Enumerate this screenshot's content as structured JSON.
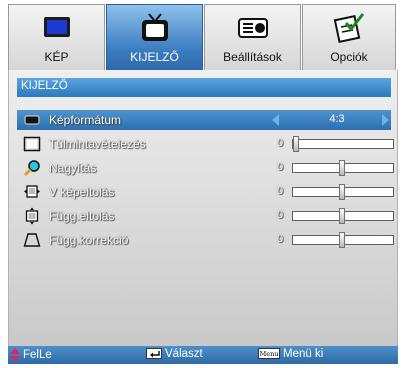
{
  "tabs": [
    {
      "label": "KÉP",
      "icon": "display-icon",
      "active": false
    },
    {
      "label": "KIJELZŐ",
      "icon": "tv-icon",
      "active": true
    },
    {
      "label": "Beállítások",
      "icon": "projector-icon",
      "active": false
    },
    {
      "label": "Opciók",
      "icon": "checklist-icon",
      "active": false
    }
  ],
  "section": {
    "title": "KIJELZŐ"
  },
  "menu": {
    "rows": [
      {
        "label": "Képformátum",
        "icon": "aspect-ratio-icon",
        "value": "4:3",
        "type": "choice",
        "selected": true
      },
      {
        "label": "Túlmintavételezés",
        "icon": "overscan-icon",
        "value": "0",
        "type": "slider",
        "level": 0.0
      },
      {
        "label": "Nagyítás",
        "icon": "magnifier-icon",
        "value": "0",
        "type": "slider",
        "level": 0.5
      },
      {
        "label": "V képeltolás",
        "icon": "h-shift-icon",
        "value": "0",
        "type": "slider",
        "level": 0.5
      },
      {
        "label": "Függ.eltolás",
        "icon": "v-shift-icon",
        "value": "0",
        "type": "slider",
        "level": 0.5
      },
      {
        "label": "Függ.korrekció",
        "icon": "keystone-icon",
        "value": "0",
        "type": "slider",
        "level": 0.5
      }
    ]
  },
  "footer": {
    "updown": "FelLe",
    "select_key": "enter-key-icon",
    "select": "Választ",
    "menu_key": "Menu",
    "menu": "Menü ki"
  },
  "colors": {
    "accent": "#2b78bd",
    "active_tab": "#3a7cc0",
    "arrow": "#6fb2ea",
    "updown_arrow": "#e0245e"
  }
}
